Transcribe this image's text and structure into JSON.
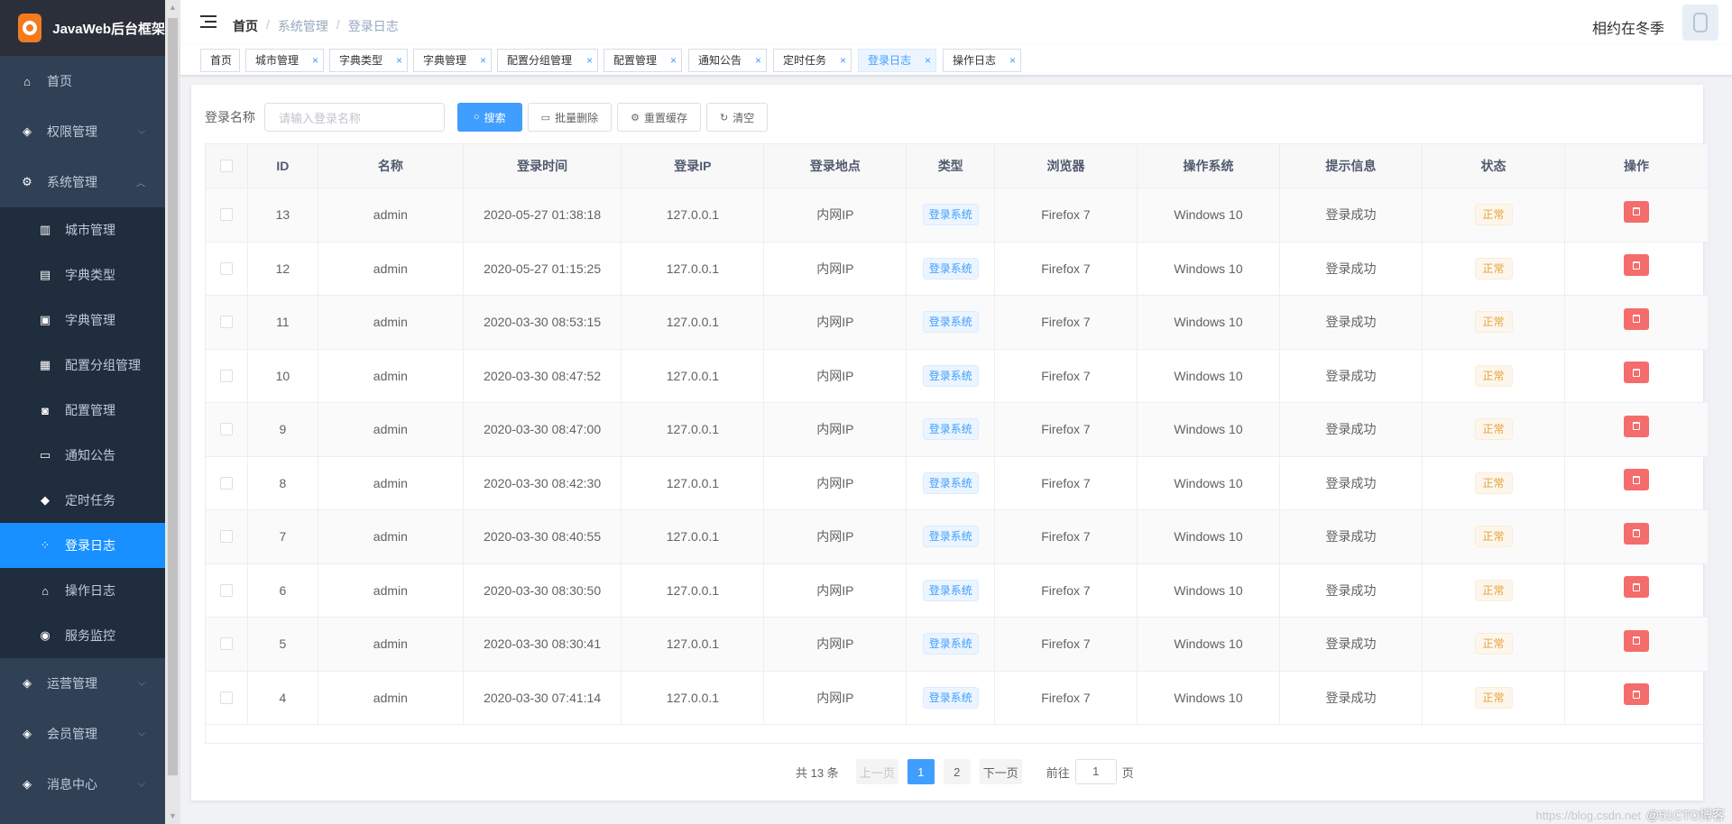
{
  "app": {
    "title": "JavaWeb后台框架"
  },
  "sidebar": {
    "items": [
      {
        "label": "首页",
        "icon": "home-icon",
        "glyph": "⌂"
      },
      {
        "label": "权限管理",
        "icon": "key-icon",
        "glyph": "◈"
      },
      {
        "label": "系统管理",
        "icon": "gear-icon",
        "glyph": "⚙"
      }
    ],
    "sub_items": [
      {
        "label": "城市管理",
        "icon": "chart-icon",
        "glyph": "▥"
      },
      {
        "label": "字典类型",
        "icon": "book-icon",
        "glyph": "▤"
      },
      {
        "label": "字典管理",
        "icon": "dict-icon",
        "glyph": "▣"
      },
      {
        "label": "配置分组管理",
        "icon": "grid-icon",
        "glyph": "▦"
      },
      {
        "label": "配置管理",
        "icon": "search-doc-icon",
        "glyph": "◙"
      },
      {
        "label": "通知公告",
        "icon": "ad-icon",
        "glyph": "▭"
      },
      {
        "label": "定时任务",
        "icon": "tag-icon",
        "glyph": "◆"
      },
      {
        "label": "登录日志",
        "icon": "dots-icon",
        "glyph": "⁘"
      },
      {
        "label": "操作日志",
        "icon": "home-icon",
        "glyph": "⌂"
      },
      {
        "label": "服务监控",
        "icon": "monitor-icon",
        "glyph": "◉"
      }
    ],
    "bottom_items": [
      {
        "label": "运营管理",
        "icon": "cube-icon",
        "glyph": "◈"
      },
      {
        "label": "会员管理",
        "icon": "key-icon",
        "glyph": "◈"
      },
      {
        "label": "消息中心",
        "icon": "key-icon",
        "glyph": "◈"
      }
    ]
  },
  "header": {
    "breadcrumb": [
      "首页",
      "系统管理",
      "登录日志"
    ],
    "user": "相约在冬季"
  },
  "tags": [
    "首页",
    "城市管理",
    "字典类型",
    "字典管理",
    "配置分组管理",
    "配置管理",
    "通知公告",
    "定时任务",
    "登录日志",
    "操作日志"
  ],
  "search": {
    "label": "登录名称",
    "placeholder": "请输入登录名称",
    "buttons": {
      "search": "搜索",
      "batch_delete": "批量删除",
      "reset_cache": "重置缓存",
      "clear": "清空"
    }
  },
  "table": {
    "columns": [
      "ID",
      "名称",
      "登录时间",
      "登录IP",
      "登录地点",
      "类型",
      "浏览器",
      "操作系统",
      "提示信息",
      "状态",
      "操作"
    ],
    "rows": [
      {
        "id": "13",
        "name": "admin",
        "time": "2020-05-27 01:38:18",
        "ip": "127.0.0.1",
        "location": "内网IP",
        "type": "登录系统",
        "browser": "Firefox 7",
        "os": "Windows 10",
        "msg": "登录成功",
        "status": "正常"
      },
      {
        "id": "12",
        "name": "admin",
        "time": "2020-05-27 01:15:25",
        "ip": "127.0.0.1",
        "location": "内网IP",
        "type": "登录系统",
        "browser": "Firefox 7",
        "os": "Windows 10",
        "msg": "登录成功",
        "status": "正常"
      },
      {
        "id": "11",
        "name": "admin",
        "time": "2020-03-30 08:53:15",
        "ip": "127.0.0.1",
        "location": "内网IP",
        "type": "登录系统",
        "browser": "Firefox 7",
        "os": "Windows 10",
        "msg": "登录成功",
        "status": "正常"
      },
      {
        "id": "10",
        "name": "admin",
        "time": "2020-03-30 08:47:52",
        "ip": "127.0.0.1",
        "location": "内网IP",
        "type": "登录系统",
        "browser": "Firefox 7",
        "os": "Windows 10",
        "msg": "登录成功",
        "status": "正常"
      },
      {
        "id": "9",
        "name": "admin",
        "time": "2020-03-30 08:47:00",
        "ip": "127.0.0.1",
        "location": "内网IP",
        "type": "登录系统",
        "browser": "Firefox 7",
        "os": "Windows 10",
        "msg": "登录成功",
        "status": "正常"
      },
      {
        "id": "8",
        "name": "admin",
        "time": "2020-03-30 08:42:30",
        "ip": "127.0.0.1",
        "location": "内网IP",
        "type": "登录系统",
        "browser": "Firefox 7",
        "os": "Windows 10",
        "msg": "登录成功",
        "status": "正常"
      },
      {
        "id": "7",
        "name": "admin",
        "time": "2020-03-30 08:40:55",
        "ip": "127.0.0.1",
        "location": "内网IP",
        "type": "登录系统",
        "browser": "Firefox 7",
        "os": "Windows 10",
        "msg": "登录成功",
        "status": "正常"
      },
      {
        "id": "6",
        "name": "admin",
        "time": "2020-03-30 08:30:50",
        "ip": "127.0.0.1",
        "location": "内网IP",
        "type": "登录系统",
        "browser": "Firefox 7",
        "os": "Windows 10",
        "msg": "登录成功",
        "status": "正常"
      },
      {
        "id": "5",
        "name": "admin",
        "time": "2020-03-30 08:30:41",
        "ip": "127.0.0.1",
        "location": "内网IP",
        "type": "登录系统",
        "browser": "Firefox 7",
        "os": "Windows 10",
        "msg": "登录成功",
        "status": "正常"
      },
      {
        "id": "4",
        "name": "admin",
        "time": "2020-03-30 07:41:14",
        "ip": "127.0.0.1",
        "location": "内网IP",
        "type": "登录系统",
        "browser": "Firefox 7",
        "os": "Windows 10",
        "msg": "登录成功",
        "status": "正常"
      }
    ]
  },
  "pagination": {
    "total_text": "共 13 条",
    "prev": "上一页",
    "pages": [
      "1",
      "2"
    ],
    "next": "下一页",
    "goto_label": "前往",
    "goto_value": "1",
    "goto_suffix": "页"
  },
  "watermark": {
    "faint": "https://blog.csdn.net",
    "text": "@51CTO博客"
  },
  "colors": {
    "sidebar_bg": "#304156",
    "accent": "#409eff",
    "danger": "#f56c6c",
    "warning": "#e6a23c"
  }
}
